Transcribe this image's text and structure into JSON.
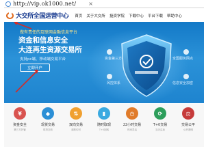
{
  "browser": {
    "url": "http://vip.ok1000.net/",
    "close_label": "×"
  },
  "header": {
    "logo_text": "大交所全国运营中心",
    "nav": [
      "首页",
      "关于大交所",
      "投资学院",
      "下载中心",
      "平台下载",
      "帮助中心"
    ]
  },
  "hero": {
    "tagline": "做有责任的互联网金融信息平台",
    "headline_1": "资金和信息安全",
    "headline_2": "大连再生资源交易所",
    "subline": "支持pc端、移动端交易平台",
    "cta_label": "立即开户",
    "features": [
      "资金第三方托管",
      "风控体系",
      "全国服务网点",
      "信息安全加密"
    ]
  },
  "features": [
    {
      "label": "资金安全",
      "desc": "第三方托管",
      "color": "#d9534f"
    },
    {
      "label": "现货交易",
      "desc": "现货交收",
      "color": "#2b8fd6"
    },
    {
      "label": "双向交易",
      "desc": "涨跌均可",
      "color": "#f0a030"
    },
    {
      "label": "随时取现",
      "desc": "T+0回转",
      "color": "#3aa9e0"
    },
    {
      "label": "22小时交易",
      "desc": "时间灵活",
      "color": "#e07b2a"
    },
    {
      "label": "T+0交易",
      "desc": "当天买卖",
      "color": "#2d9e5b"
    },
    {
      "label": "交易公平",
      "desc": "公开透明",
      "color": "#c63b3b"
    }
  ],
  "colors": {
    "brand_blue": "#1d3f92",
    "hero_blue": "#1f86cf",
    "annotation_red": "#d62a24"
  }
}
